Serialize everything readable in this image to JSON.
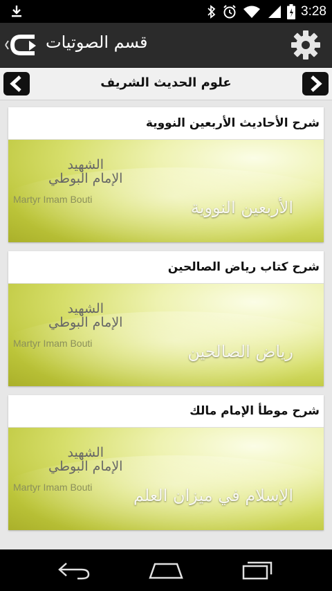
{
  "status_bar": {
    "time": "3:28"
  },
  "header": {
    "title": "قسم الصوتيات"
  },
  "sub_header": {
    "title": "علوم الحديث الشريف"
  },
  "items": [
    {
      "title": "شرح الأحاديث الأربعين النووية",
      "banner_caption": "الأربعين النووية"
    },
    {
      "title": "شرح كتاب رياض الصالحين",
      "banner_caption": "رياض الصالحين"
    },
    {
      "title": "شرح موطأ الإمام مالك",
      "banner_caption": "الإسلام في ميزان العلم"
    }
  ],
  "logo": {
    "arabic_line1": "الشهيد",
    "arabic_line2": "الإمام البوطي",
    "english": "Martyr Imam Bouti"
  },
  "colors": {
    "action_bar": "#2b2b2b",
    "banner_green": "#bcc53a",
    "background": "#e7e7e7"
  }
}
